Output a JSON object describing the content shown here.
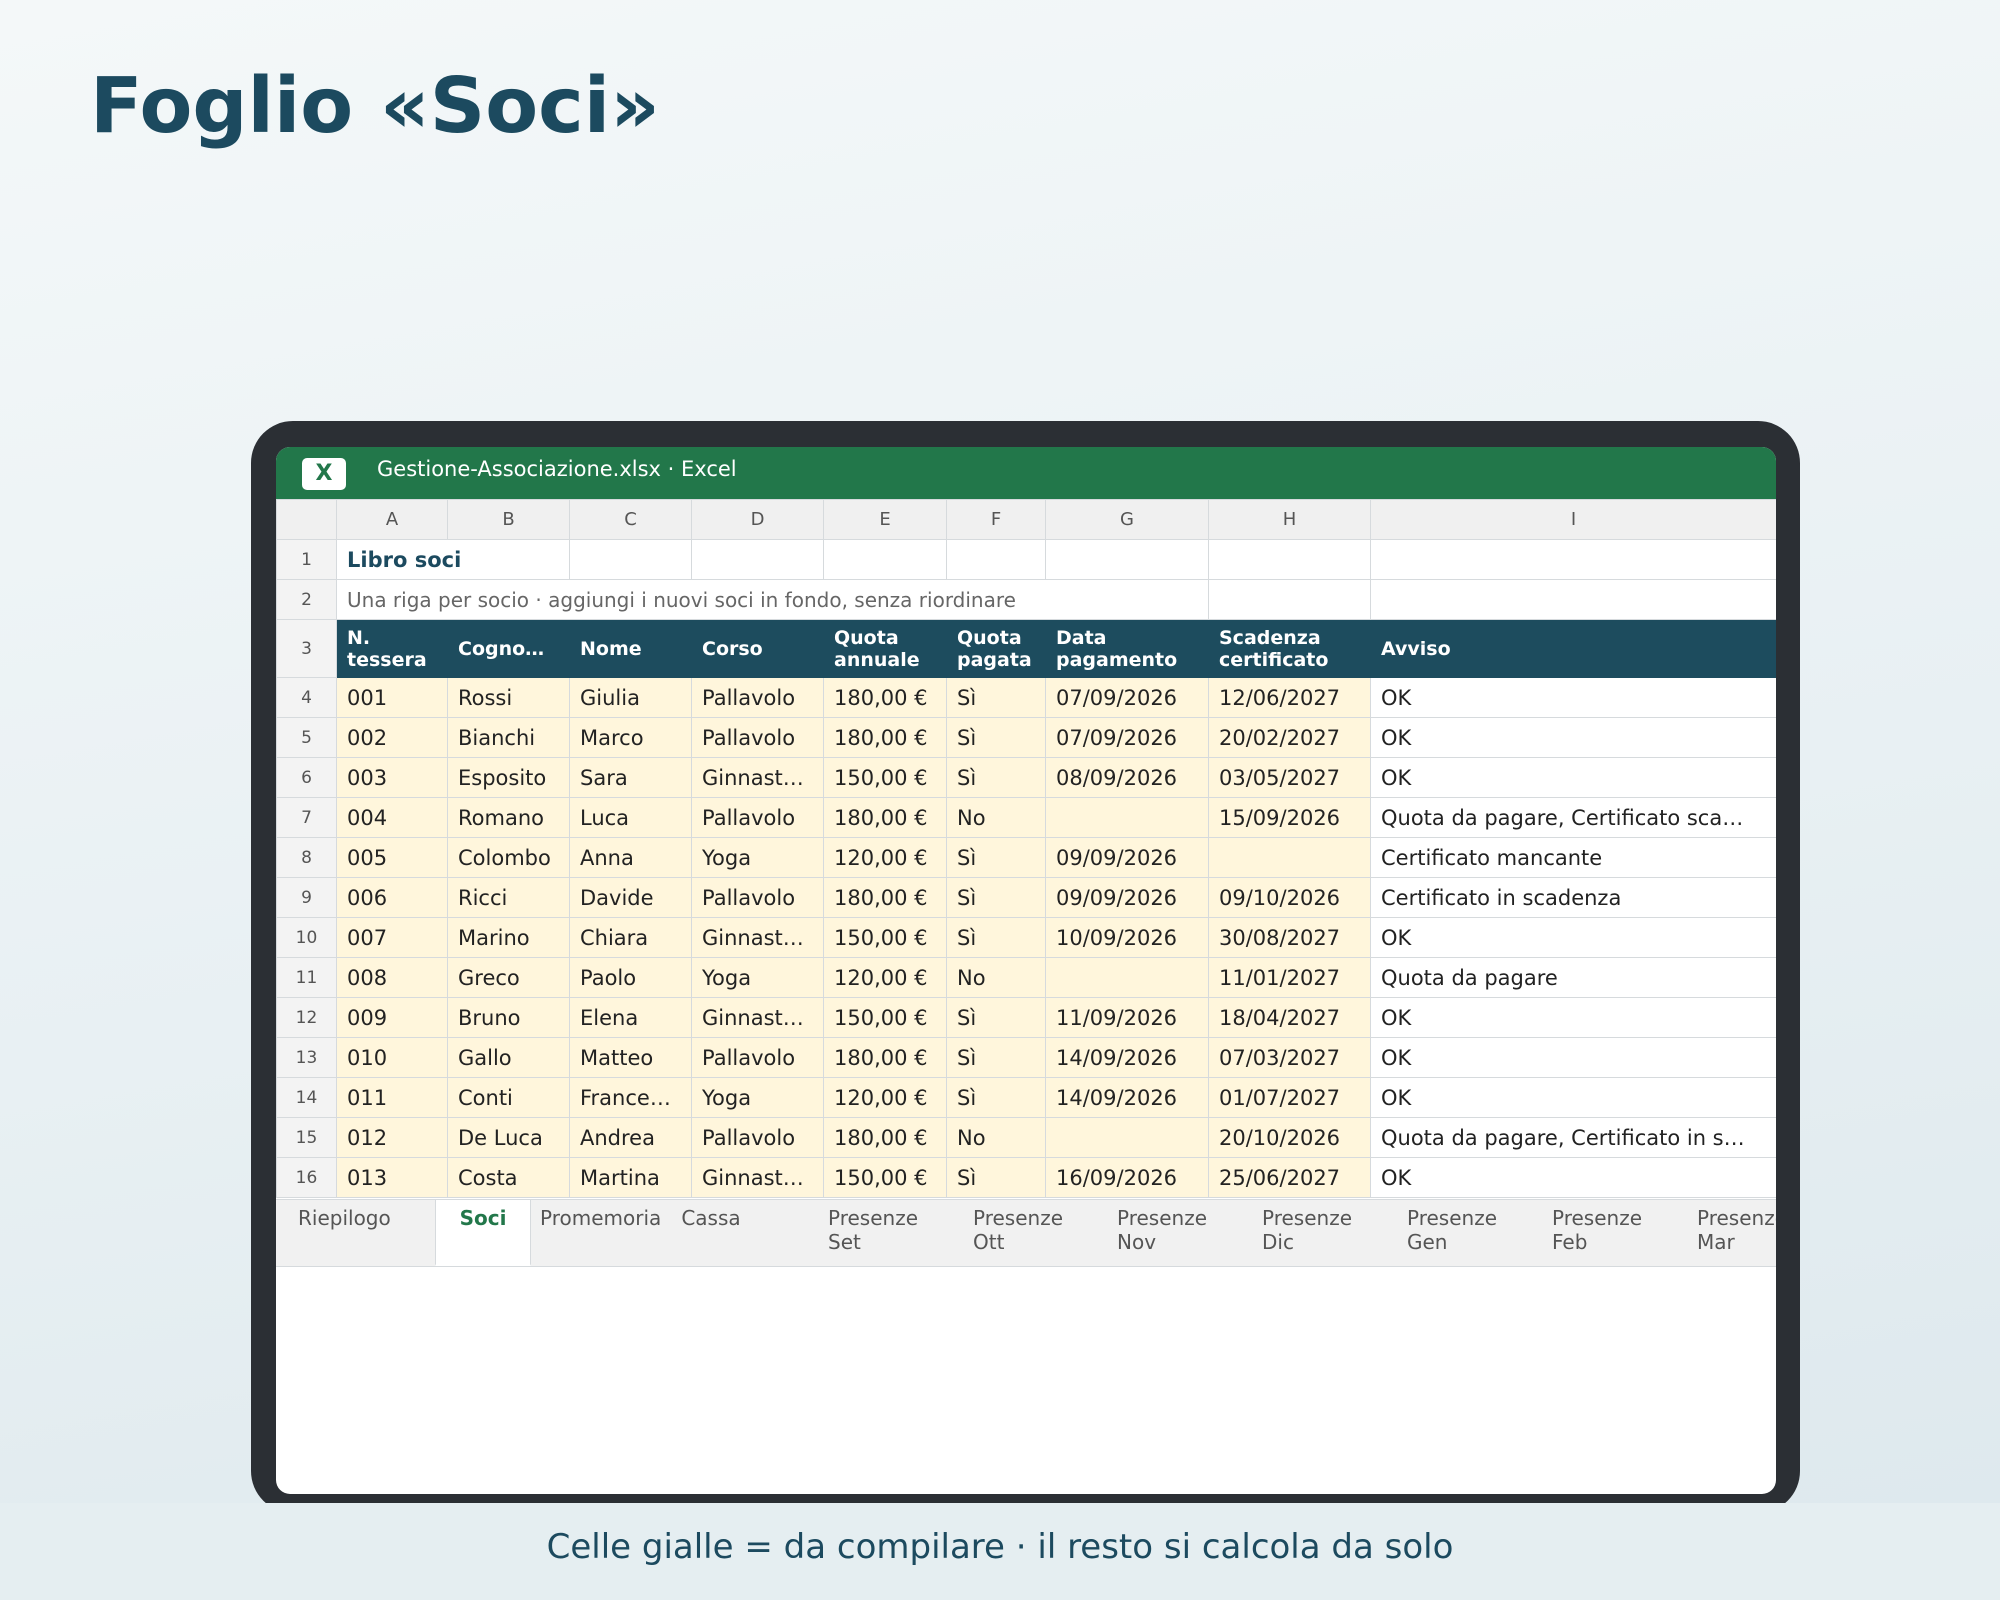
{
  "page_title": "Foglio «Soci»",
  "caption": "Celle gialle = da compilare · il resto si calcola da solo",
  "window": {
    "app_icon_label": "X",
    "title": "Gestione-Associazione.xlsx · Excel"
  },
  "colors": {
    "excel_green": "#22774a",
    "header_teal": "#1d4c5e",
    "input_yellow": "#fff6dc",
    "title_blue": "#1c4a5f"
  },
  "columns": [
    "A",
    "B",
    "C",
    "D",
    "E",
    "F",
    "G",
    "H",
    "I"
  ],
  "row_numbers": [
    "1",
    "2",
    "3",
    "4",
    "5",
    "6",
    "7",
    "8",
    "9",
    "10",
    "11",
    "12",
    "13",
    "14",
    "15",
    "16"
  ],
  "sheet": {
    "title": "Libro soci",
    "subtitle": "Una riga per socio · aggiungi i nuovi soci in fondo, senza riordinare",
    "headers": [
      "N. tessera",
      "Cogno…",
      "Nome",
      "Corso",
      "Quota annuale",
      "Quota pagata",
      "Data pagamento",
      "Scadenza certificato",
      "Avviso"
    ],
    "rows": [
      [
        "001",
        "Rossi",
        "Giulia",
        "Pallavolo",
        "180,00 €",
        "Sì",
        "07/09/2026",
        "12/06/2027",
        "OK"
      ],
      [
        "002",
        "Bianchi",
        "Marco",
        "Pallavolo",
        "180,00 €",
        "Sì",
        "07/09/2026",
        "20/02/2027",
        "OK"
      ],
      [
        "003",
        "Esposito",
        "Sara",
        "Ginnast…",
        "150,00 €",
        "Sì",
        "08/09/2026",
        "03/05/2027",
        "OK"
      ],
      [
        "004",
        "Romano",
        "Luca",
        "Pallavolo",
        "180,00 €",
        "No",
        "",
        "15/09/2026",
        "Quota da pagare, Certificato sca…"
      ],
      [
        "005",
        "Colombo",
        "Anna",
        "Yoga",
        "120,00 €",
        "Sì",
        "09/09/2026",
        "",
        "Certificato mancante"
      ],
      [
        "006",
        "Ricci",
        "Davide",
        "Pallavolo",
        "180,00 €",
        "Sì",
        "09/09/2026",
        "09/10/2026",
        "Certificato in scadenza"
      ],
      [
        "007",
        "Marino",
        "Chiara",
        "Ginnast…",
        "150,00 €",
        "Sì",
        "10/09/2026",
        "30/08/2027",
        "OK"
      ],
      [
        "008",
        "Greco",
        "Paolo",
        "Yoga",
        "120,00 €",
        "No",
        "",
        "11/01/2027",
        "Quota da pagare"
      ],
      [
        "009",
        "Bruno",
        "Elena",
        "Ginnast…",
        "150,00 €",
        "Sì",
        "11/09/2026",
        "18/04/2027",
        "OK"
      ],
      [
        "010",
        "Gallo",
        "Matteo",
        "Pallavolo",
        "180,00 €",
        "Sì",
        "14/09/2026",
        "07/03/2027",
        "OK"
      ],
      [
        "011",
        "Conti",
        "France…",
        "Yoga",
        "120,00 €",
        "Sì",
        "14/09/2026",
        "01/07/2027",
        "OK"
      ],
      [
        "012",
        "De Luca",
        "Andrea",
        "Pallavolo",
        "180,00 €",
        "No",
        "",
        "20/10/2026",
        "Quota da pagare, Certificato in s…"
      ],
      [
        "013",
        "Costa",
        "Martina",
        "Ginnast…",
        "150,00 €",
        "Sì",
        "16/09/2026",
        "25/06/2027",
        "OK"
      ]
    ]
  },
  "tabs": [
    {
      "label": "Riepilogo",
      "active": false
    },
    {
      "label": "Soci",
      "active": true
    },
    {
      "label": "Promemoria",
      "active": false
    },
    {
      "label": "Cassa",
      "active": false
    },
    {
      "label": "Presenze Set",
      "active": false
    },
    {
      "label": "Presenze Ott",
      "active": false
    },
    {
      "label": "Presenze Nov",
      "active": false
    },
    {
      "label": "Presenze Dic",
      "active": false
    },
    {
      "label": "Presenze Gen",
      "active": false
    },
    {
      "label": "Presenze Feb",
      "active": false
    },
    {
      "label": "Presenze Mar",
      "active": false
    }
  ]
}
